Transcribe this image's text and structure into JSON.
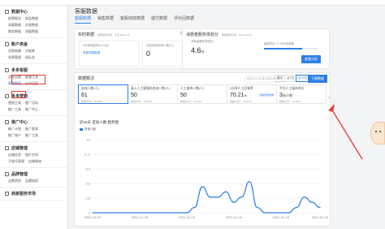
{
  "page": {
    "title": "客服数据"
  },
  "tabs": [
    {
      "label": "客服数据"
    },
    {
      "label": "销售数据"
    },
    {
      "label": "客服绩效数据"
    },
    {
      "label": "催付数据"
    },
    {
      "label": "评价回数据"
    }
  ],
  "sidebar": {
    "groups": [
      {
        "title": "数据中心",
        "links": [
          "经营概况",
          "商品数据",
          "流量数据",
          "交易数据",
          "服务数据",
          "流量数据"
        ]
      },
      {
        "title": "账户资金",
        "links": [
          "货款结算",
          "对账单",
          "发票管理",
          "保证金"
        ]
      },
      {
        "title": "多多客服",
        "links": [
          "消息设置",
          "客服工具",
          "客服数据",
          "自动回复"
        ]
      },
      {
        "title": "多多营销",
        "links": [
          "营销工具",
          "推广活动",
          "推广工具",
          "推广中心"
        ]
      },
      {
        "title": "推广中心",
        "links": [
          "推广计划",
          "推广报表",
          "推广账户",
          "推广工具"
        ]
      },
      {
        "title": "店铺管理",
        "links": [
          "店铺信息",
          "图片空间",
          "子账号管理",
          "店铺装修"
        ]
      },
      {
        "title": "品牌管理",
        "links": [
          "品牌资质",
          "品牌授权"
        ]
      },
      {
        "title": "商家服务市场",
        "links": []
      }
    ]
  },
  "realtime": {
    "title": "实时数据",
    "sub": "数据更新时间：今天 09:22:10",
    "more": "查看更多",
    "box1_label": "3分钟回复率(5-23点)",
    "box1_link": "查看完整数据",
    "box2_label": "当前咨询买家人数(人)",
    "box2_value": "0"
  },
  "service_score": {
    "title": "消费者服务体验分",
    "sub": "数据更新时间：2021-01-16",
    "label": "消费者服务体验分",
    "value": "4.6",
    "unit": "分",
    "desc": "超越同行 71.20%的商家",
    "fill": 0.712,
    "button": "查看分析"
  },
  "overview": {
    "title": "数据概况",
    "date_range": "2020-12-22 至 2021-01-20",
    "seg": [
      "昨天",
      "近7天",
      "近30天"
    ],
    "download": "下载数据",
    "kpis": [
      {
        "label": "咨询人数(人)",
        "value": "61",
        "unit": "",
        "cmp": "较前30天 ↓ -30.68%",
        "link": ""
      },
      {
        "label": "接入人工客服的咨询人数(人)",
        "value": "50",
        "unit": "",
        "cmp": "较前30天 ↓ -34.21%",
        "link": ""
      },
      {
        "label": "人工接待人数(人)",
        "value": "50",
        "unit": "",
        "cmp": "较前30天 ↓ -34.21%",
        "link": ""
      },
      {
        "label": "3分钟人工回复率",
        "value": "70.21",
        "unit": "%",
        "cmp": "较前30天 ↓ -10.97%",
        "link": "查看完整数据"
      },
      {
        "label": "平均人工接待时长",
        "value": "3",
        "unit": "分27秒",
        "cmp": "较前30天 ↑ +9.45%",
        "link": ""
      }
    ]
  },
  "trend": {
    "title": "近30天 咨询人数 趋势图",
    "legend": "咨询人数"
  },
  "chart_data": {
    "type": "line",
    "title": "",
    "xlabel": "",
    "ylabel": "",
    "ylim": [
      0,
      14
    ],
    "y_ticks": [
      "14",
      "11.2",
      "8.4",
      "5.6",
      "2.8",
      "0"
    ],
    "x_ticks": [
      "2020-12-22",
      "2020-12-28",
      "2021-01-03",
      "2021-01-09",
      "2021-01-15",
      "2021-01-20"
    ],
    "x": [
      "2020-12-22",
      "2020-12-23",
      "2020-12-24",
      "2020-12-25",
      "2020-12-26",
      "2020-12-27",
      "2020-12-28",
      "2020-12-29",
      "2020-12-30",
      "2020-12-31",
      "2021-01-01",
      "2021-01-02",
      "2021-01-03",
      "2021-01-04",
      "2021-01-05",
      "2021-01-06",
      "2021-01-07",
      "2021-01-08",
      "2021-01-09",
      "2021-01-10",
      "2021-01-11",
      "2021-01-12",
      "2021-01-13",
      "2021-01-14",
      "2021-01-15",
      "2021-01-16",
      "2021-01-17",
      "2021-01-18",
      "2021-01-19",
      "2021-01-20"
    ],
    "series": [
      {
        "name": "咨询人数",
        "values": [
          0,
          0,
          0,
          0,
          0,
          0,
          0,
          0,
          0,
          0,
          0,
          0,
          0,
          1,
          5,
          3,
          3,
          4,
          2,
          3,
          6,
          1,
          0,
          0,
          0,
          0,
          1,
          3,
          2,
          1
        ]
      }
    ],
    "color": "#2d7fe6"
  }
}
